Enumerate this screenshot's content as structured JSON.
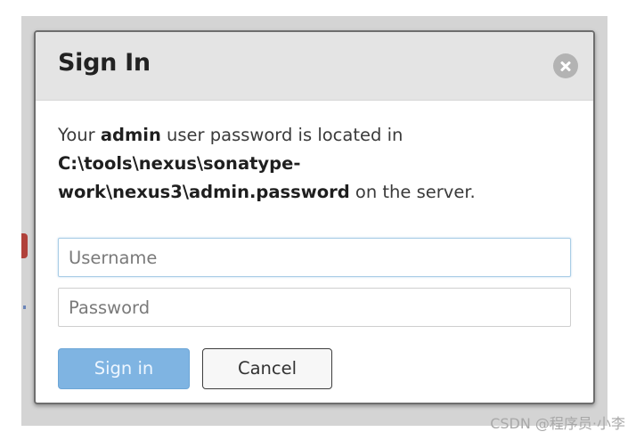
{
  "dialog": {
    "title": "Sign In",
    "message": {
      "part1": "Your ",
      "user_bold": "admin",
      "part2": " user password is located in ",
      "path_line1": "C:\\tools\\nexus\\sonatype-",
      "path_line2": "work\\nexus3\\admin.password",
      "part3": " on the server."
    },
    "username_placeholder": "Username",
    "password_placeholder": "Password",
    "signin_label": "Sign in",
    "cancel_label": "Cancel"
  },
  "icons": {
    "close": "close-icon"
  },
  "colors": {
    "header_bg": "#e4e4e4",
    "signin_button": "#7fb4e2",
    "username_focus_border": "#a9cde6"
  },
  "watermark": "CSDN @程序员·小李"
}
